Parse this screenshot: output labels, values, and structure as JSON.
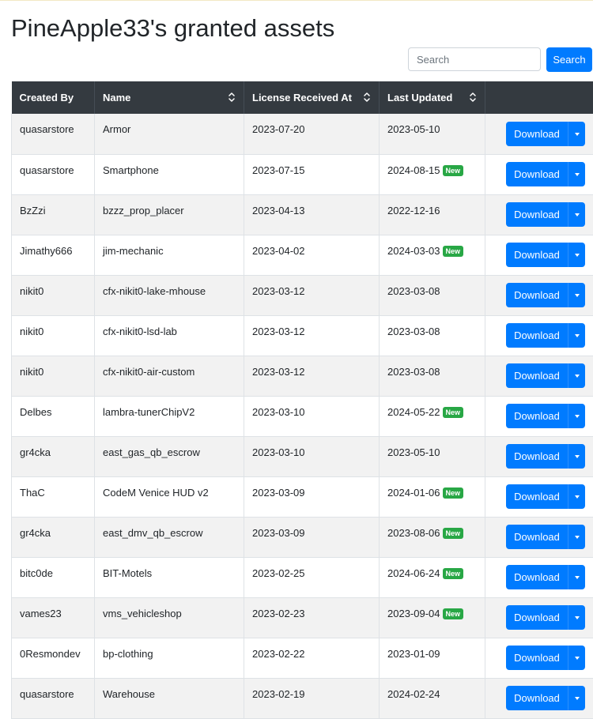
{
  "page": {
    "title": "PineApple33's granted assets"
  },
  "search": {
    "placeholder": "Search",
    "button_label": "Search"
  },
  "table": {
    "headers": {
      "created_by": "Created By",
      "name": "Name",
      "license_received_at": "License Received At",
      "last_updated": "Last Updated"
    },
    "sortable_columns": [
      "Name",
      "License Received At",
      "Last Updated"
    ],
    "download_label": "Download",
    "new_badge_label": "New",
    "rows": [
      {
        "created_by": "quasarstore",
        "name": "Armor",
        "license_received_at": "2023-07-20",
        "last_updated": "2023-05-10",
        "is_new": false
      },
      {
        "created_by": "quasarstore",
        "name": "Smartphone",
        "license_received_at": "2023-07-15",
        "last_updated": "2024-08-15",
        "is_new": true
      },
      {
        "created_by": "BzZzi",
        "name": "bzzz_prop_placer",
        "license_received_at": "2023-04-13",
        "last_updated": "2022-12-16",
        "is_new": false
      },
      {
        "created_by": "Jimathy666",
        "name": "jim-mechanic",
        "license_received_at": "2023-04-02",
        "last_updated": "2024-03-03",
        "is_new": true
      },
      {
        "created_by": "nikit0",
        "name": "cfx-nikit0-lake-mhouse",
        "license_received_at": "2023-03-12",
        "last_updated": "2023-03-08",
        "is_new": false
      },
      {
        "created_by": "nikit0",
        "name": "cfx-nikit0-lsd-lab",
        "license_received_at": "2023-03-12",
        "last_updated": "2023-03-08",
        "is_new": false
      },
      {
        "created_by": "nikit0",
        "name": "cfx-nikit0-air-custom",
        "license_received_at": "2023-03-12",
        "last_updated": "2023-03-08",
        "is_new": false
      },
      {
        "created_by": "Delbes",
        "name": "lambra-tunerChipV2",
        "license_received_at": "2023-03-10",
        "last_updated": "2024-05-22",
        "is_new": true
      },
      {
        "created_by": "gr4cka",
        "name": "east_gas_qb_escrow",
        "license_received_at": "2023-03-10",
        "last_updated": "2023-05-10",
        "is_new": false
      },
      {
        "created_by": "ThaC",
        "name": "CodeM Venice HUD v2",
        "license_received_at": "2023-03-09",
        "last_updated": "2024-01-06",
        "is_new": true
      },
      {
        "created_by": "gr4cka",
        "name": "east_dmv_qb_escrow",
        "license_received_at": "2023-03-09",
        "last_updated": "2023-08-06",
        "is_new": true
      },
      {
        "created_by": "bitc0de",
        "name": "BIT-Motels",
        "license_received_at": "2023-02-25",
        "last_updated": "2024-06-24",
        "is_new": true
      },
      {
        "created_by": "vames23",
        "name": "vms_vehicleshop",
        "license_received_at": "2023-02-23",
        "last_updated": "2023-09-04",
        "is_new": true
      },
      {
        "created_by": "0Resmondev",
        "name": "bp-clothing",
        "license_received_at": "2023-02-22",
        "last_updated": "2023-01-09",
        "is_new": false
      },
      {
        "created_by": "quasarstore",
        "name": "Warehouse",
        "license_received_at": "2023-02-19",
        "last_updated": "2024-02-24",
        "is_new": false
      }
    ]
  },
  "colors": {
    "primary": "#007bff",
    "header_bg": "#343a40",
    "badge_new": "#28a745",
    "row_stripe": "#f2f2f2"
  }
}
